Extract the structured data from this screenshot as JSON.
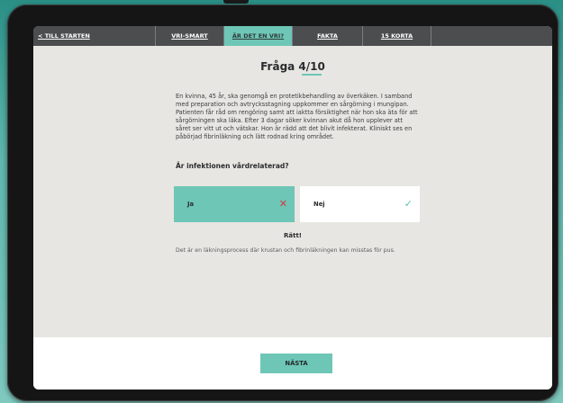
{
  "nav": {
    "back_label": "< TILL STARTEN",
    "tabs": [
      {
        "label": "VRI-SMART",
        "active": false
      },
      {
        "label": "ÄR DET EN VRI?",
        "active": true
      },
      {
        "label": "FAKTA",
        "active": false
      },
      {
        "label": "15 KORTA",
        "active": false
      }
    ]
  },
  "quiz": {
    "title": "Fråga 4/10",
    "question_text": "En kvinna, 45 år, ska genomgå en protetikbehandling av överkäken. I samband med preparation och avtrycksstagning uppkommer en sårgörning i mungipan. Patienten får råd om rengöring samt att iaktta försiktighet när hon ska äta för att sårgörningen ska läka. Efter 3 dagar söker kvinnan akut då hon upplever att såret ser vitt ut och vätskar. Hon är rädd att det blivit infekterat. Kliniskt ses en påbörjad fibrinläkning och lätt rodnad kring området.",
    "sub_question": "Är infektionen vårdrelaterad?",
    "answers": [
      {
        "label": "Ja",
        "mark": "cross-icon",
        "selected": true
      },
      {
        "label": "Nej",
        "mark": "check-icon",
        "selected": false
      }
    ],
    "result": "Rätt!",
    "explanation": "Det är en läkningsprocess där krustan och fibrinläkningen kan misstas för pus."
  },
  "footer": {
    "next_label": "NÄSTA"
  },
  "colors": {
    "accent": "#6ec6b7",
    "nav_bg": "#4b4d4f",
    "wrong": "#d9363e",
    "right": "#5bbfae"
  }
}
